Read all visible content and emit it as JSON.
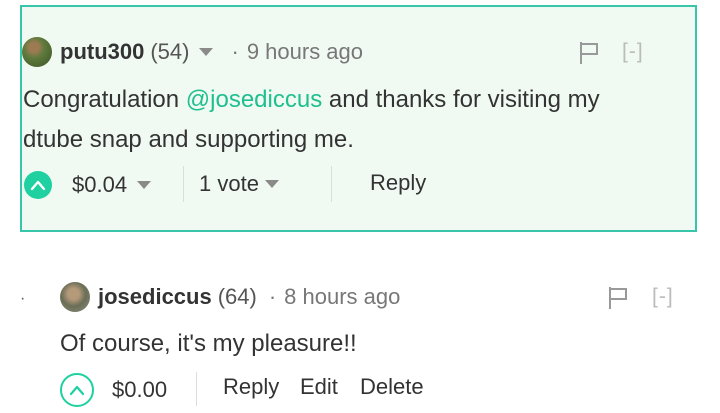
{
  "comment1": {
    "author": "putu300",
    "reputation": "(54)",
    "separator": "·",
    "time": "9 hours ago",
    "collapse": "[-]",
    "body_before": "Congratulation ",
    "mention": "@josediccus",
    "body_after": " and thanks for visiting my",
    "body_line2": "dtube snap and supporting me.",
    "payout": "$0.04",
    "votes": "1 vote",
    "reply": "Reply"
  },
  "comment2": {
    "bullet": "·",
    "author": "josediccus",
    "reputation": "(64)",
    "separator": "·",
    "time": "8 hours ago",
    "collapse": "[-]",
    "body": "Of course, it's my pleasure!!",
    "payout": "$0.00",
    "reply": "Reply",
    "edit": "Edit",
    "delete": "Delete"
  },
  "colors": {
    "accent": "#1fd1a0",
    "highlight_border": "#37c6a9",
    "highlight_bg": "#f0faf2",
    "mention": "#1fbf8f"
  }
}
